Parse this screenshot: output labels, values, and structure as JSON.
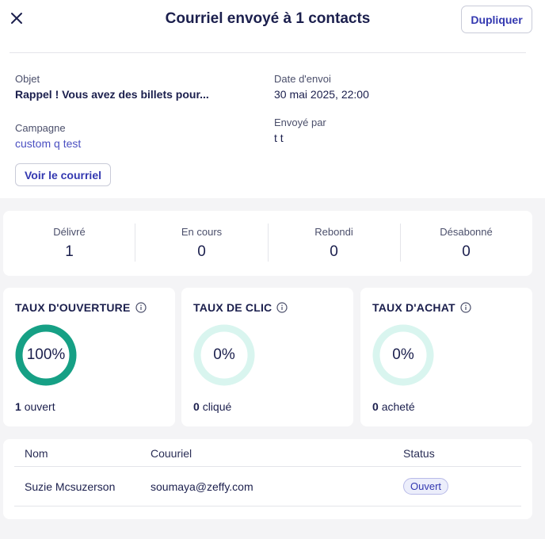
{
  "header": {
    "title": "Courriel envoyé à 1 contacts",
    "duplicate_label": "Dupliquer"
  },
  "details": {
    "subject_label": "Objet",
    "subject_value": "Rappel ! Vous avez des billets pour...",
    "sent_date_label": "Date d'envoi",
    "sent_date_value": "30 mai 2025, 22:00",
    "campaign_label": "Campagne",
    "campaign_value": "custom q test",
    "sent_by_label": "Envoyé par",
    "sent_by_value": "t t",
    "view_email_label": "Voir le courriel"
  },
  "stats": [
    {
      "label": "Délivré",
      "value": "1"
    },
    {
      "label": "En cours",
      "value": "0"
    },
    {
      "label": "Rebondi",
      "value": "0"
    },
    {
      "label": "Désabonné",
      "value": "0"
    }
  ],
  "rates": [
    {
      "title": "TAUX D'OUVERTURE",
      "percent_text": "100%",
      "percent": 100,
      "count": "1",
      "count_label": "ouvert"
    },
    {
      "title": "TAUX DE CLIC",
      "percent_text": "0%",
      "percent": 0,
      "count": "0",
      "count_label": "cliqué"
    },
    {
      "title": "TAUX D'ACHAT",
      "percent_text": "0%",
      "percent": 0,
      "count": "0",
      "count_label": "acheté"
    }
  ],
  "table": {
    "columns": [
      "Nom",
      "Couuriel",
      "Status"
    ],
    "rows": [
      {
        "name": "Suzie Mcsuzerson",
        "email": "soumaya@zeffy.com",
        "status": "Ouvert"
      }
    ]
  },
  "colors": {
    "donut_fill": "#16a085",
    "donut_track": "#d9f5ef",
    "accent": "#3338b0"
  }
}
